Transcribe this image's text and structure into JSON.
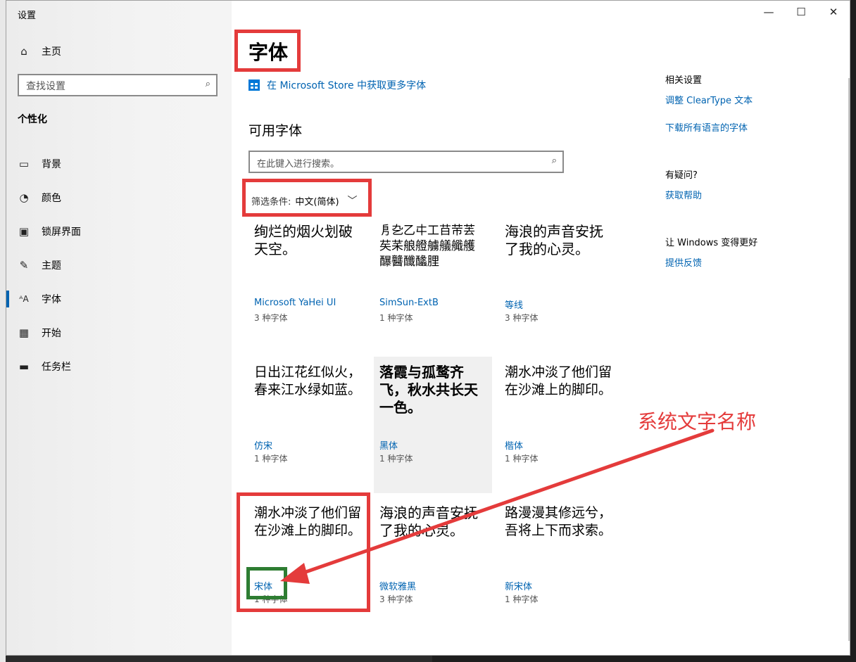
{
  "window": {
    "title": "设置",
    "controls": [
      "—",
      "☐",
      "✕"
    ]
  },
  "sidebar": {
    "home_label": "主页",
    "search_placeholder": "查找设置",
    "section_title": "个性化",
    "items": [
      {
        "label": "背景",
        "icon": "picture-icon",
        "glyph": "▭"
      },
      {
        "label": "颜色",
        "icon": "palette-icon",
        "glyph": "◔"
      },
      {
        "label": "锁屏界面",
        "icon": "lock-screen-icon",
        "glyph": "▣"
      },
      {
        "label": "主题",
        "icon": "theme-icon",
        "glyph": "✎"
      },
      {
        "label": "字体",
        "icon": "font-icon",
        "glyph": "ᴬA",
        "active": true
      },
      {
        "label": "开始",
        "icon": "start-icon",
        "glyph": "▦"
      },
      {
        "label": "任务栏",
        "icon": "taskbar-icon",
        "glyph": "▬"
      }
    ]
  },
  "main": {
    "title": "字体",
    "store_link": "在 Microsoft Store 中获取更多字体",
    "available_heading": "可用字体",
    "search_placeholder": "在此键入进行搜索。",
    "filter_label": "筛选条件:",
    "filter_value": "中文(简体)",
    "fonts": [
      {
        "sample": "绚烂的烟火划破天空。",
        "name": "Microsoft YaHei UI",
        "count": "3 种字体",
        "style": "sans"
      },
      {
        "sample": "㐆㐇乙㐄工䒤䒥䒧䒨䒩艆艠艣艤艥艧䤖䤗䤘䤙䤚",
        "name": "SimSun-ExtB",
        "count": "1 种字体",
        "style": "serif small"
      },
      {
        "sample": "海浪的声音安抚了我的心灵。",
        "name": "等线",
        "count": "3 种字体",
        "style": "sans"
      },
      {
        "sample": "日出江花红似火，春来江水绿如蓝。",
        "name": "仿宋",
        "count": "1 种字体",
        "style": "serif"
      },
      {
        "sample": "落霞与孤鹜齐飞，秋水共长天一色。",
        "name": "黑体",
        "count": "1 种字体",
        "style": "sans",
        "highlight": true
      },
      {
        "sample": "潮水冲淡了他们留在沙滩上的脚印。",
        "name": "楷体",
        "count": "1 种字体",
        "style": "serif"
      },
      {
        "sample": "潮水冲淡了他们留在沙滩上的脚印。",
        "name": "宋体",
        "count": "1 种字体",
        "style": "serif"
      },
      {
        "sample": "海浪的声音安抚了我的心灵。",
        "name": "微软雅黑",
        "count": "3 种字体",
        "style": "sans"
      },
      {
        "sample": "路漫漫其修远兮，吾将上下而求索。",
        "name": "新宋体",
        "count": "1 种字体",
        "style": "serif"
      }
    ]
  },
  "related": {
    "heading": "相关设置",
    "link_cleartype": "调整 ClearType 文本",
    "link_download": "下载所有语言的字体",
    "question_heading": "有疑问?",
    "link_help": "获取帮助",
    "better_heading": "让 Windows 变得更好",
    "link_feedback": "提供反馈"
  },
  "annotation": {
    "label": "系统文字名称",
    "color": "#e43b3b",
    "green": "#2e7d32"
  }
}
